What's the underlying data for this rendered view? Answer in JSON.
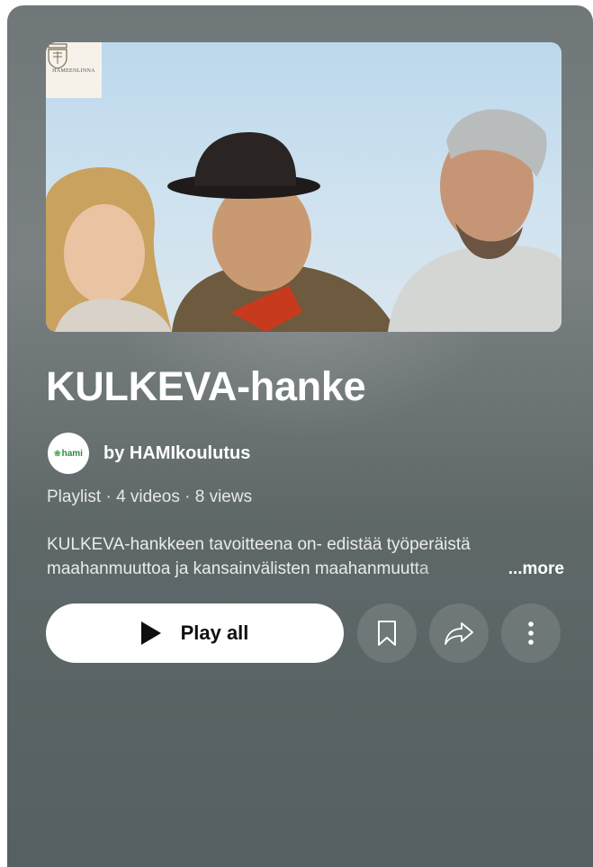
{
  "thumbnail": {
    "logo_text": "HAMEENLINNA"
  },
  "playlist": {
    "title": "KULKEVA-hanke",
    "channel": "by HAMIkoulutus",
    "avatar_text": "hami",
    "meta": "Playlist · 4 videos · 8 views",
    "description_line1": "KULKEVA-hankkeen tavoitteena on- edistää työperäistä",
    "description_line2": "maahanmuuttoa ja kansainvälisten maahanmuutta",
    "more_label": "...more"
  },
  "actions": {
    "play_all_label": "Play all"
  },
  "icons": {
    "play": "play-icon",
    "save": "bookmark-icon",
    "share": "share-icon",
    "more": "more-vert-icon"
  },
  "colors": {
    "panel_top": "#6f7778",
    "panel_bottom": "#556062",
    "button_bg": "#ffffff",
    "text": "#ffffff"
  }
}
